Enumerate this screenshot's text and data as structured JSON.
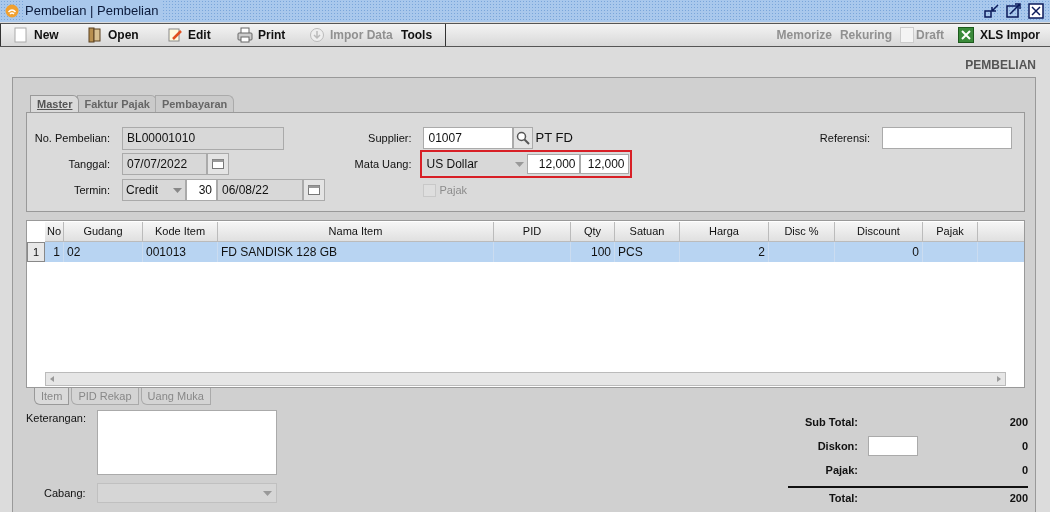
{
  "window": {
    "title": "Pembelian | Pembelian"
  },
  "toolbar": {
    "left": [
      {
        "kind": "new",
        "label": "New",
        "disabled": false
      },
      {
        "kind": "open",
        "label": "Open",
        "disabled": false
      },
      {
        "kind": "edit",
        "label": "Edit",
        "disabled": false
      },
      {
        "kind": "print",
        "label": "Print",
        "disabled": false
      },
      {
        "kind": "import",
        "label": "Impor Data",
        "disabled": true
      },
      {
        "kind": "tools",
        "label": "Tools",
        "disabled": false
      }
    ],
    "right": [
      {
        "kind": "button",
        "label": "Memorize",
        "disabled": true
      },
      {
        "kind": "button",
        "label": "Rekuring",
        "disabled": true
      },
      {
        "kind": "checkbox",
        "label": "Draft",
        "disabled": true,
        "checked": false
      },
      {
        "kind": "xls",
        "label": "XLS Impor",
        "disabled": false
      }
    ]
  },
  "header": "PEMBELIAN",
  "tabs": [
    {
      "label": "Master",
      "selected": true
    },
    {
      "label": "Faktur Pajak",
      "selected": false
    },
    {
      "label": "Pembayaran",
      "selected": false
    }
  ],
  "master": {
    "no_pembelian": {
      "label": "No. Pembelian:",
      "value": "BL00001010"
    },
    "tanggal": {
      "label": "Tanggal:",
      "value": "07/07/2022"
    },
    "termin": {
      "label": "Termin:",
      "type": "Credit",
      "days": "30",
      "due": "06/08/22"
    },
    "supplier": {
      "label": "Supplier:",
      "code": "01007",
      "name": "PT FD"
    },
    "mata_uang": {
      "label": "Mata Uang:",
      "currency": "US Dollar",
      "rate_1": "12,000",
      "rate_2": "12,000",
      "highlighted": true
    },
    "pajak": {
      "label": "Pajak",
      "checked": false,
      "disabled": true
    },
    "referensi": {
      "label": "Referensi:"
    }
  },
  "table": {
    "columns": [
      "No",
      "Gudang",
      "Kode Item",
      "Nama Item",
      "PID",
      "Qty",
      "Satuan",
      "Harga",
      "Disc %",
      "Discount",
      "Pajak"
    ],
    "rows": [
      {
        "row_header": "1",
        "selected": true,
        "cells": [
          "1",
          "02",
          "001013",
          "FD SANDISK 128 GB",
          null,
          "100",
          "PCS",
          "2",
          null,
          "0",
          null
        ]
      }
    ]
  },
  "bottom_tabs": [
    {
      "label": "Item",
      "selected": true,
      "disabled": true
    },
    {
      "label": "PID Rekap",
      "selected": false,
      "disabled": true
    },
    {
      "label": "Uang Muka",
      "selected": false,
      "disabled": true
    }
  ],
  "keterangan": {
    "label": "Keterangan:"
  },
  "cabang": {
    "label": "Cabang:",
    "disabled": true
  },
  "totals": [
    {
      "kind": "plain",
      "label": "Sub Total:",
      "value": "200"
    },
    {
      "kind": "input",
      "label": "Diskon:",
      "value": "0"
    },
    {
      "kind": "plain",
      "label": "Pajak:",
      "value": "0"
    },
    {
      "kind": "total",
      "label": "Total:",
      "value": "200"
    }
  ]
}
